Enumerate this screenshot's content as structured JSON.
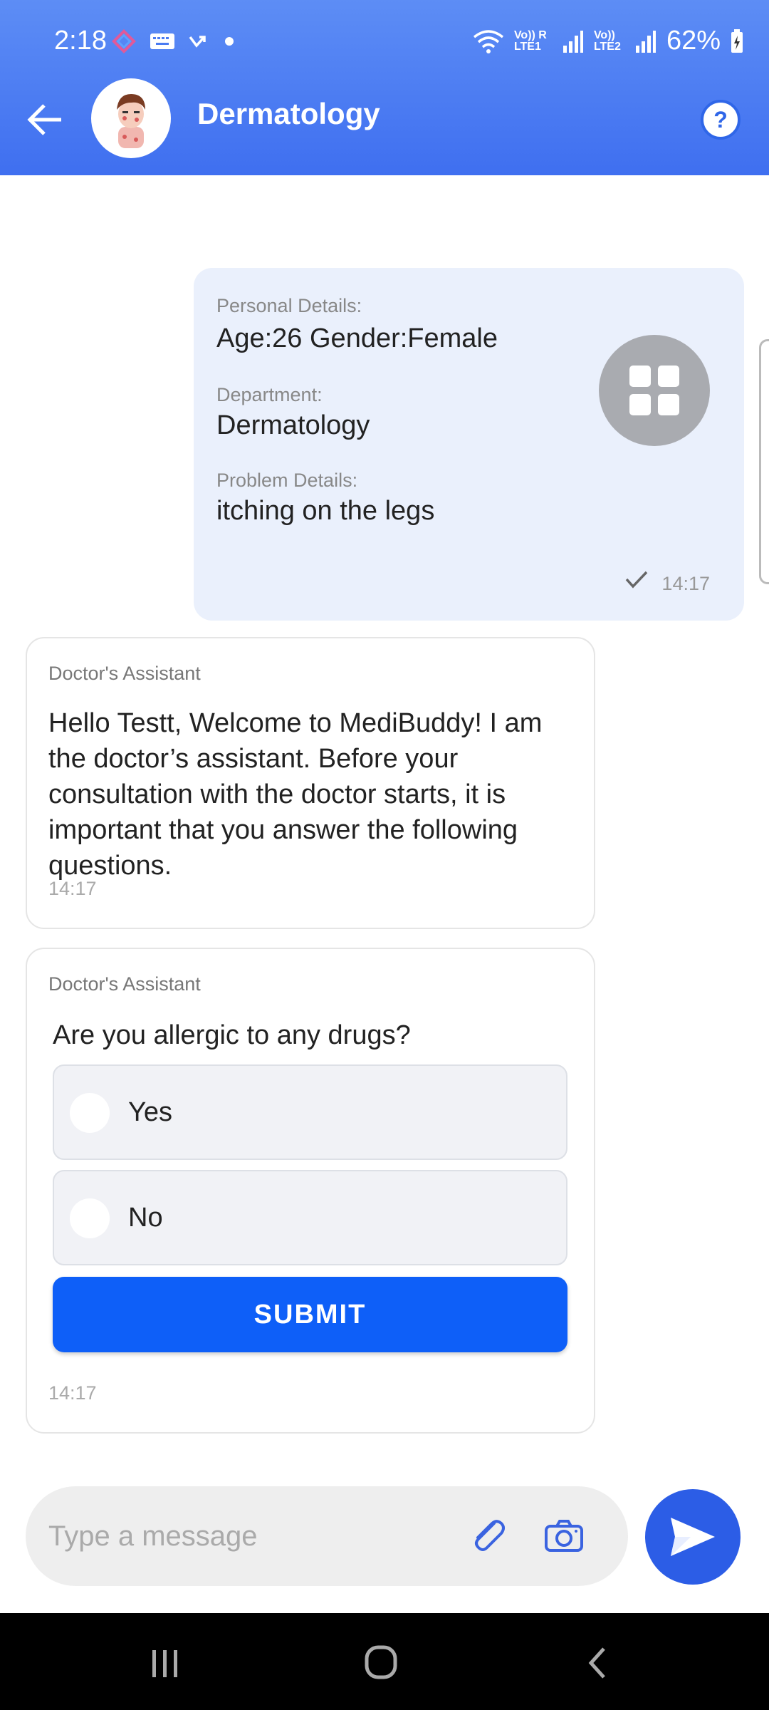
{
  "status_bar": {
    "time": "2:18",
    "sim1_label": "Vo)) R LTE1",
    "sim2_label": "Vo)) LTE2",
    "battery": "62%"
  },
  "header": {
    "title": "Dermatology",
    "help_icon": "help-circle-icon",
    "back_icon": "arrow-left-icon"
  },
  "user_message": {
    "personal_label": "Personal Details:",
    "personal_value": "Age:26 Gender:Female",
    "department_label": "Department:",
    "department_value": "Dermatology",
    "problem_label": "Problem Details:",
    "problem_value": "itching on the legs",
    "time": "14:17",
    "status": "sent"
  },
  "welcome_message": {
    "sender": "Doctor's Assistant",
    "text": "Hello Testt, Welcome to MediBuddy! I am the doctor’s assistant. Before your consultation with the doctor starts, it is important that you answer the following questions.",
    "time": "14:17"
  },
  "question_message": {
    "sender": "Doctor's Assistant",
    "question": "Are you allergic to any drugs?",
    "options": [
      "Yes",
      "No"
    ],
    "selected": null,
    "submit_label": "SUBMIT",
    "time": "14:17"
  },
  "composer": {
    "placeholder": "Type a message",
    "value": ""
  },
  "colors": {
    "header": "#3f6ff0",
    "accent": "#0e5ff8",
    "send_button": "#2c5de6",
    "user_bubble": "#eaf0fc"
  }
}
